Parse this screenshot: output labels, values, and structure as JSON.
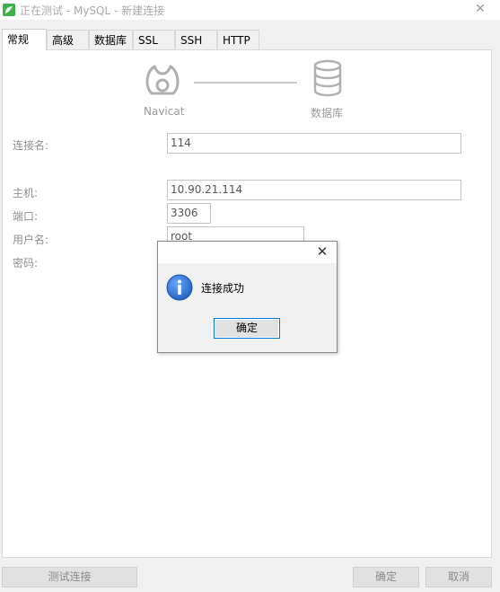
{
  "window": {
    "title": "正在测试 - MySQL - 新建连接"
  },
  "tabs": [
    {
      "label": "常规",
      "active": true
    },
    {
      "label": "高级"
    },
    {
      "label": "数据库"
    },
    {
      "label": "SSL"
    },
    {
      "label": "SSH"
    },
    {
      "label": "HTTP"
    }
  ],
  "diagram": {
    "left_caption": "Navicat",
    "right_caption": "数据库"
  },
  "form": {
    "connection_name_label": "连接名:",
    "connection_name_value": "114",
    "host_label": "主机:",
    "host_value": "10.90.21.114",
    "port_label": "端口:",
    "port_value": "3306",
    "user_label": "用户名:",
    "user_value": "root",
    "password_label": "密码:"
  },
  "buttons": {
    "test_connection": "测试连接",
    "ok": "确定",
    "cancel": "取消"
  },
  "dialog": {
    "message": "连接成功",
    "ok_label": "确定",
    "icon": "info-icon"
  },
  "colors": {
    "accent": "#0078d7",
    "info_icon": "#1f5fbf",
    "app_icon": "#3cb44a"
  }
}
